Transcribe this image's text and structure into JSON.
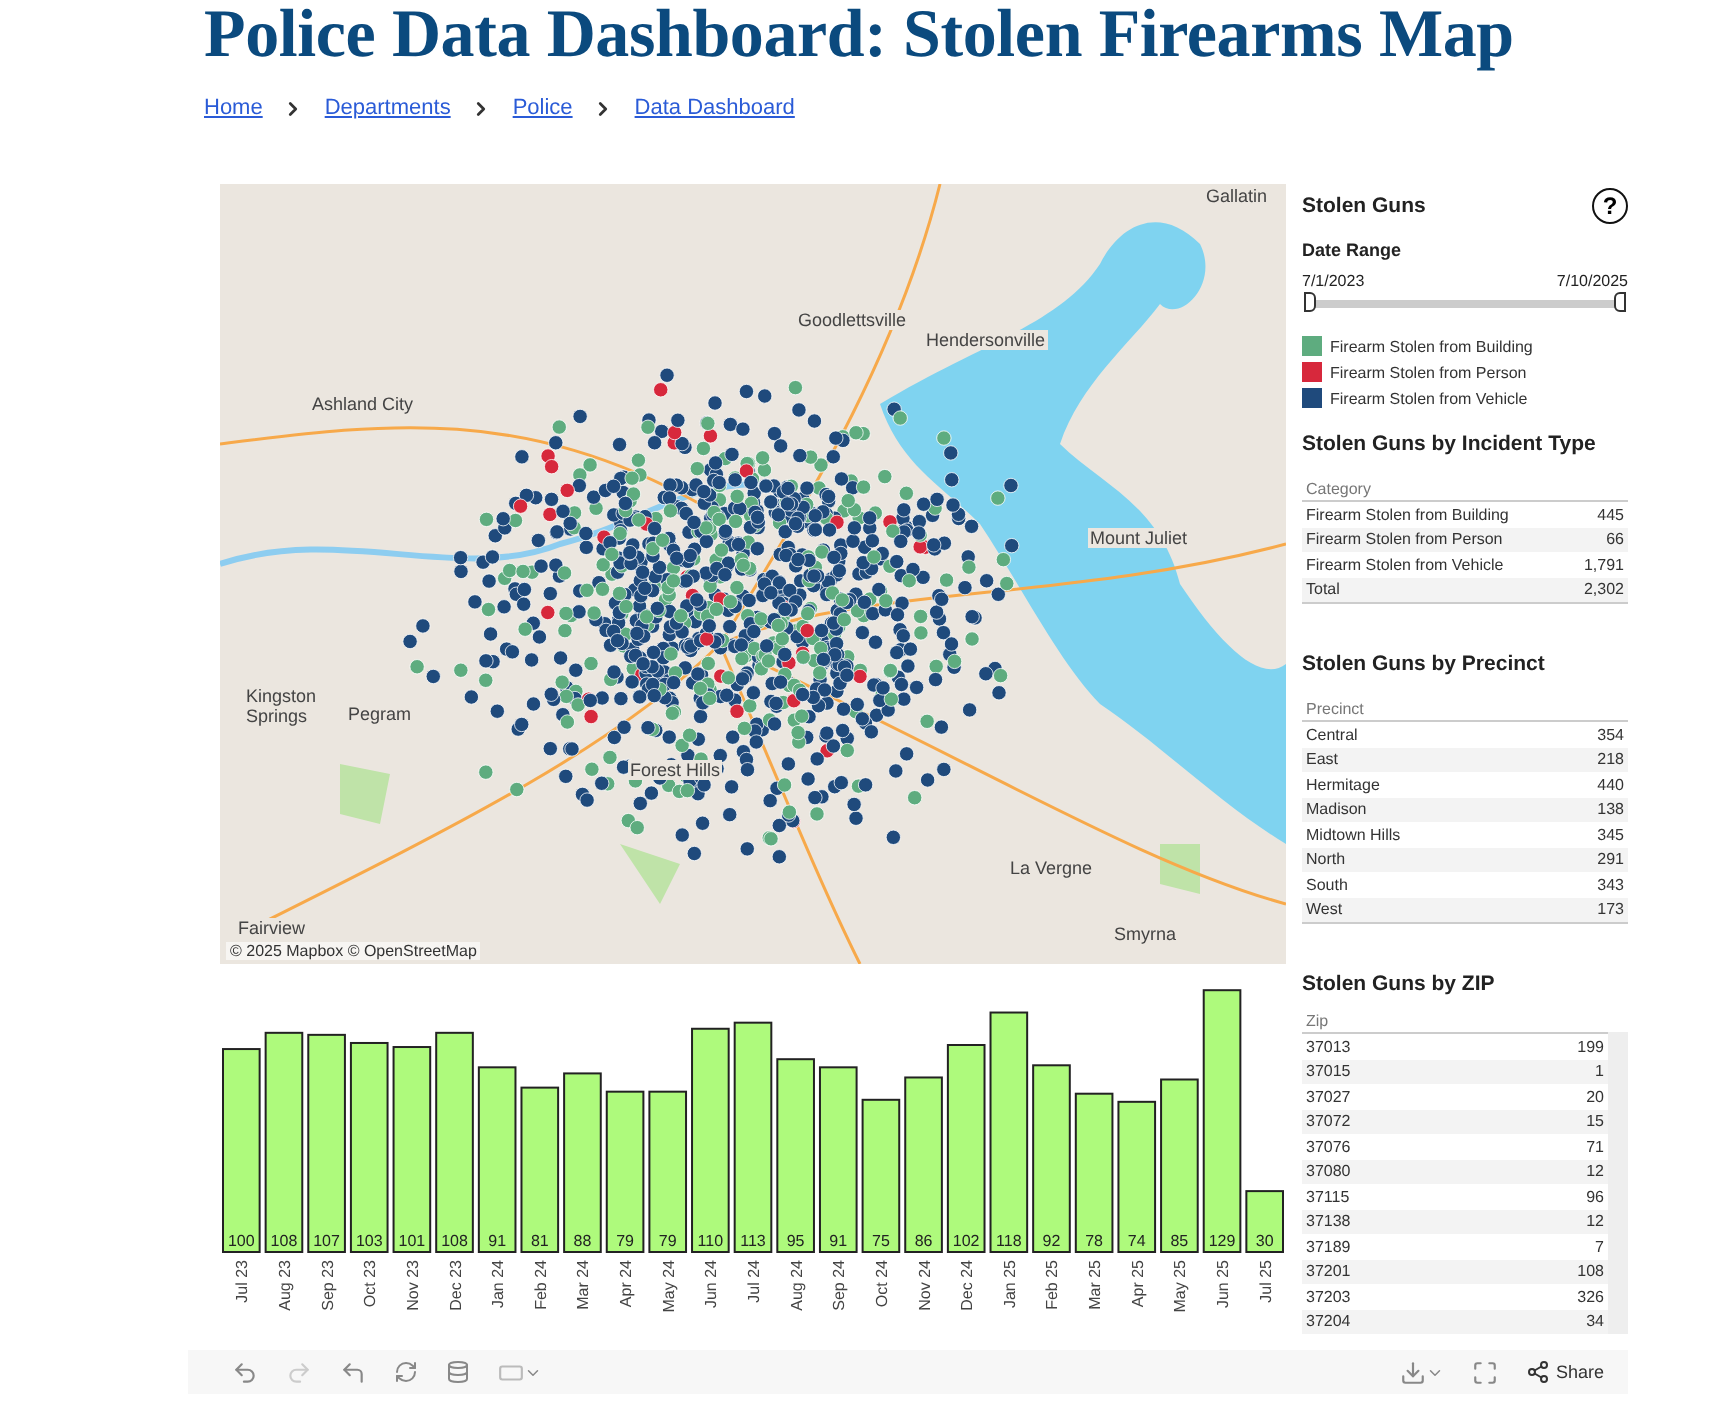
{
  "title": "Police Data Dashboard: Stolen Firearms Map",
  "breadcrumb": [
    {
      "label": "Home"
    },
    {
      "label": "Departments"
    },
    {
      "label": "Police"
    },
    {
      "label": "Data Dashboard"
    }
  ],
  "map": {
    "labels": [
      "Gallatin",
      "Goodlettsville",
      "Hendersonville",
      "Ashland City",
      "Mount Juliet",
      "Kingston Springs",
      "Pegram",
      "Forest Hills",
      "La Vergne",
      "Fairview",
      "Smyrna"
    ],
    "attribution": "© 2025 Mapbox  © OpenStreetMap"
  },
  "sidebar": {
    "title": "Stolen Guns",
    "help": "?",
    "date_range": {
      "label": "Date Range",
      "start": "7/1/2023",
      "end": "7/10/2025",
      "handles": [
        {
          "level": 0
        },
        {
          "level": 1
        }
      ]
    },
    "legend": [
      {
        "label": "Firearm Stolen from Building",
        "color": "#5eac7f"
      },
      {
        "label": "Firearm Stolen from Person",
        "color": "#d7283c"
      },
      {
        "label": "Firearm Stolen from Vehicle",
        "color": "#1f4a7c"
      }
    ],
    "by_type": {
      "title": "Stolen Guns by Incident Type",
      "header": "Category",
      "rows": [
        [
          "Firearm Stolen from Building",
          "445"
        ],
        [
          "Firearm Stolen from Person",
          "66"
        ],
        [
          "Firearm Stolen from Vehicle",
          "1,791"
        ],
        [
          "Total",
          "2,302"
        ]
      ]
    },
    "by_precinct": {
      "title": "Stolen Guns by Precinct",
      "header": "Precinct",
      "rows": [
        [
          "Central",
          "354"
        ],
        [
          "East",
          "218"
        ],
        [
          "Hermitage",
          "440"
        ],
        [
          "Madison",
          "138"
        ],
        [
          "Midtown Hills",
          "345"
        ],
        [
          "North",
          "291"
        ],
        [
          "South",
          "343"
        ],
        [
          "West",
          "173"
        ]
      ]
    },
    "by_zip": {
      "title": "Stolen Guns by ZIP",
      "header": "Zip",
      "rows": [
        [
          "37013",
          "199"
        ],
        [
          "37015",
          "1"
        ],
        [
          "37027",
          "20"
        ],
        [
          "37072",
          "15"
        ],
        [
          "37076",
          "71"
        ],
        [
          "37080",
          "12"
        ],
        [
          "37115",
          "96"
        ],
        [
          "37138",
          "12"
        ],
        [
          "37189",
          "7"
        ],
        [
          "37201",
          "108"
        ],
        [
          "37203",
          "326"
        ],
        [
          "37204",
          "34"
        ]
      ]
    }
  },
  "chart": {
    "chart_data": {
      "type": "bar",
      "categories": [
        "Jul 23",
        "Aug 23",
        "Sep 23",
        "Oct 23",
        "Nov 23",
        "Dec 23",
        "Jan 24",
        "Feb 24",
        "Mar 24",
        "Apr 24",
        "May 24",
        "Jun 24",
        "Jul 24",
        "Aug 24",
        "Sep 24",
        "Oct 24",
        "Nov 24",
        "Dec 24",
        "Jan 25",
        "Feb 25",
        "Mar 25",
        "Apr 25",
        "May 25",
        "Jun 25",
        "Jul 25"
      ],
      "values": [
        100,
        108,
        107,
        103,
        101,
        108,
        91,
        81,
        88,
        79,
        79,
        110,
        113,
        95,
        91,
        75,
        86,
        102,
        118,
        92,
        78,
        74,
        85,
        129,
        30
      ],
      "data_labels": true
    }
  },
  "toolbar": {
    "share": "Share"
  }
}
